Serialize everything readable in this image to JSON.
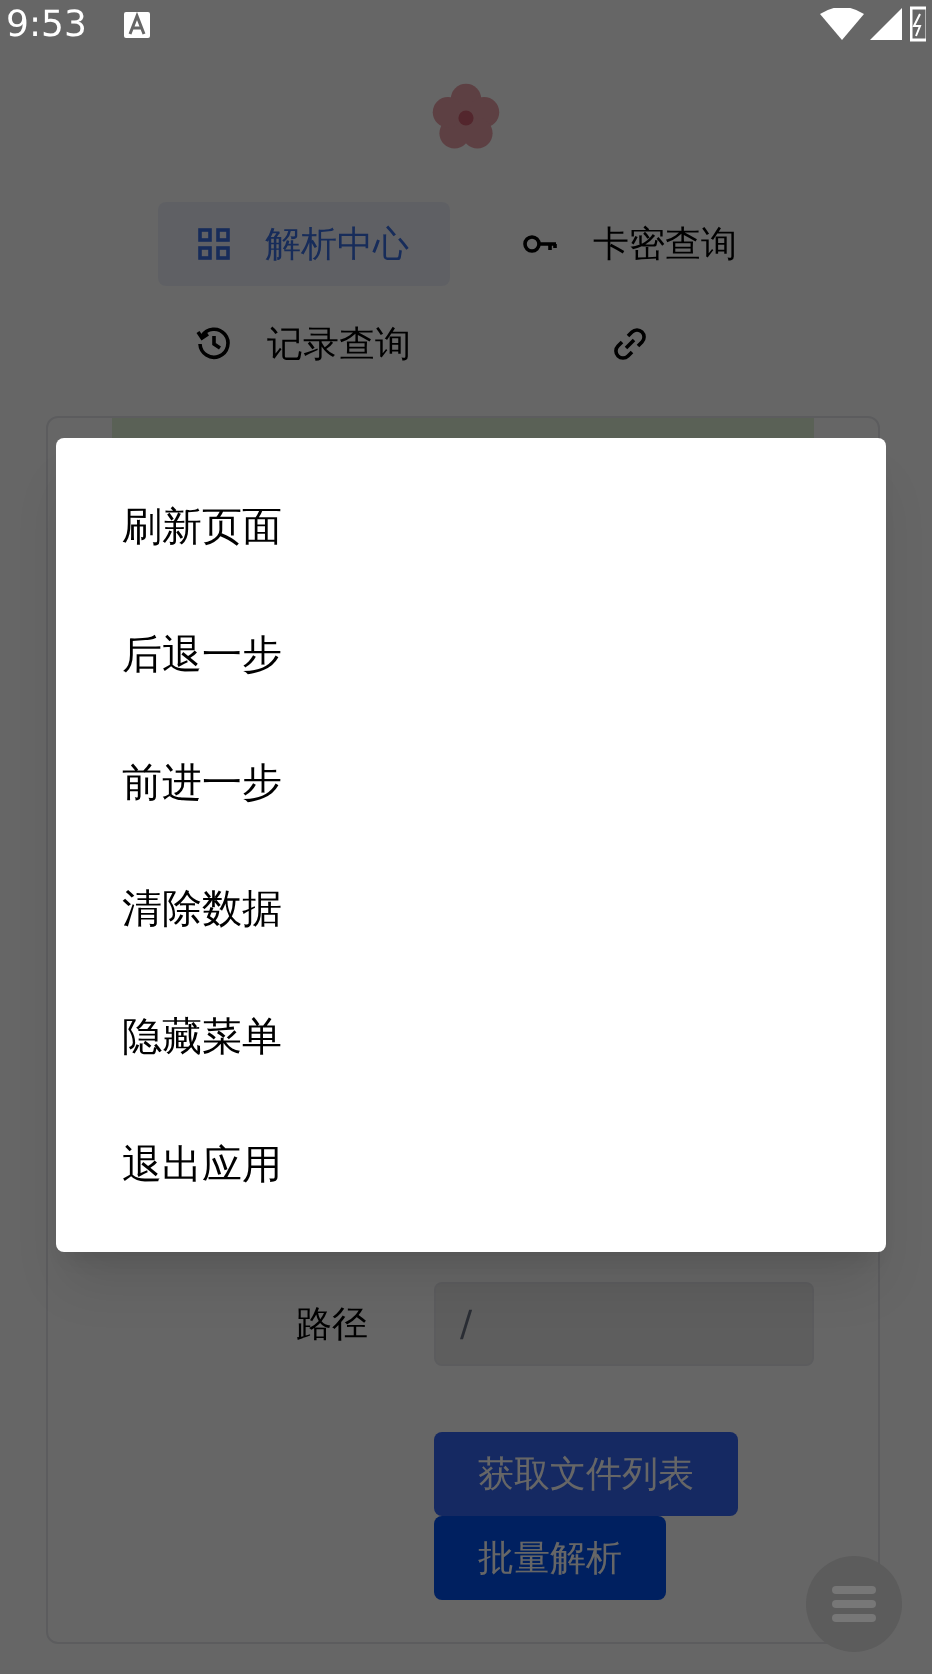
{
  "status_bar": {
    "time": "9:53"
  },
  "nav": [
    {
      "kind": "grid",
      "label": "解析中心",
      "selected": true
    },
    {
      "kind": "key",
      "label": "卡密查询",
      "selected": false
    },
    {
      "kind": "history",
      "label": "记录查询",
      "selected": false
    },
    {
      "kind": "link",
      "selected": false
    }
  ],
  "form": {
    "path_label": "路径",
    "path_value": "/",
    "buttons": [
      {
        "kind": "primary",
        "label": "获取文件列表"
      },
      {
        "kind": "dark",
        "label": "批量解析"
      }
    ]
  },
  "menu": {
    "items": [
      "刷新页面",
      "后退一步",
      "前进一步",
      "清除数据",
      "隐藏菜单",
      "退出应用"
    ]
  }
}
